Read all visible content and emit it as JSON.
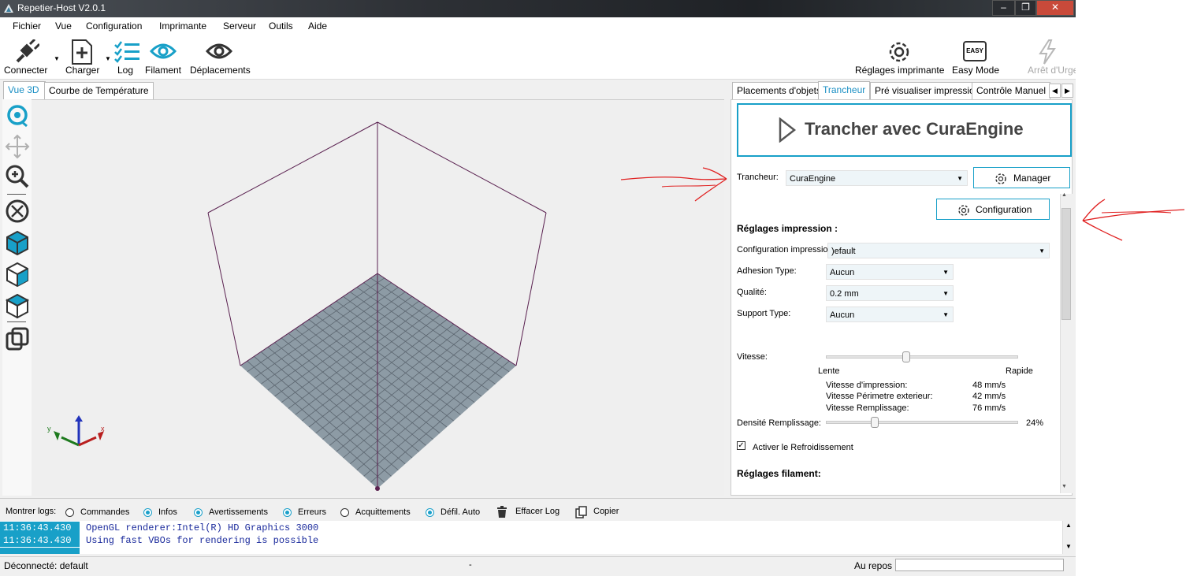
{
  "window": {
    "title": "Repetier-Host V2.0.1",
    "min": "–",
    "max": "❐",
    "close": "✕"
  },
  "menu": [
    "Fichier",
    "Vue",
    "Configuration",
    "Imprimante",
    "Serveur",
    "Outils",
    "Aide"
  ],
  "toolbar": {
    "connect": "Connecter",
    "load": "Charger",
    "log": "Log",
    "filament": "Filament",
    "moves": "Déplacements",
    "printer_settings": "Réglages imprimante",
    "easy_mode": "Easy Mode",
    "easy_badge": "EASY",
    "emergency": "Arrêt d'Urgence"
  },
  "left_tabs": [
    "Vue 3D",
    "Courbe de Température"
  ],
  "view_tools": [
    "rotate-icon",
    "move-icon",
    "zoom-icon",
    "fit-icon",
    "front-view-icon",
    "side-view-icon",
    "top-view-icon",
    "objects-icon"
  ],
  "right_tabs": [
    "Placements d'objets",
    "Trancheur",
    "Pré visualiser impression",
    "Contrôle Manuel"
  ],
  "slicer": {
    "slice_button": "Trancher avec CuraEngine",
    "slicer_label": "Trancheur:",
    "slicer_value": "CuraEngine",
    "manager_button": "Manager",
    "configuration_button": "Configuration",
    "print_settings_heading": "Réglages impression :",
    "print_config_label": "Configuration impression:",
    "print_config_value": ")efault",
    "adhesion_label": "Adhesion Type:",
    "adhesion_value": "Aucun",
    "quality_label": "Qualité:",
    "quality_value": "0.2 mm",
    "support_label": "Support Type:",
    "support_value": "Aucun",
    "speed_label": "Vitesse:",
    "speed_slow": "Lente",
    "speed_fast": "Rapide",
    "speed_slider_value": 0.41,
    "speeds": [
      {
        "label": "Vitesse d'impression:",
        "value": "48 mm/s"
      },
      {
        "label": "Vitesse Périmetre exterieur:",
        "value": "42 mm/s"
      },
      {
        "label": "Vitesse Remplissage:",
        "value": "76 mm/s"
      }
    ],
    "infill_label": "Densité Remplissage:",
    "infill_value": "24%",
    "infill_slider_value": 0.24,
    "cooling_label": "Activer le Refroidissement",
    "cooling_checked": true,
    "filament_heading": "Réglages filament:"
  },
  "log_bar": {
    "label": "Montrer logs:",
    "options": [
      {
        "label": "Commandes",
        "on": false
      },
      {
        "label": "Infos",
        "on": true
      },
      {
        "label": "Avertissements",
        "on": true
      },
      {
        "label": "Erreurs",
        "on": true
      },
      {
        "label": "Acquittements",
        "on": false
      },
      {
        "label": "Défil. Auto",
        "on": true
      }
    ],
    "clear": "Effacer Log",
    "copy": "Copier"
  },
  "log": [
    {
      "time": "11:36:43.430",
      "msg": "OpenGL renderer:Intel(R) HD Graphics 3000"
    },
    {
      "time": "11:36:43.430",
      "msg": "Using fast VBOs for rendering is possible"
    }
  ],
  "status": {
    "left": "Déconnecté: default",
    "middle": "-",
    "right": "Au repos"
  },
  "colors": {
    "accent": "#18a0c8",
    "annotation": "#e02020"
  }
}
